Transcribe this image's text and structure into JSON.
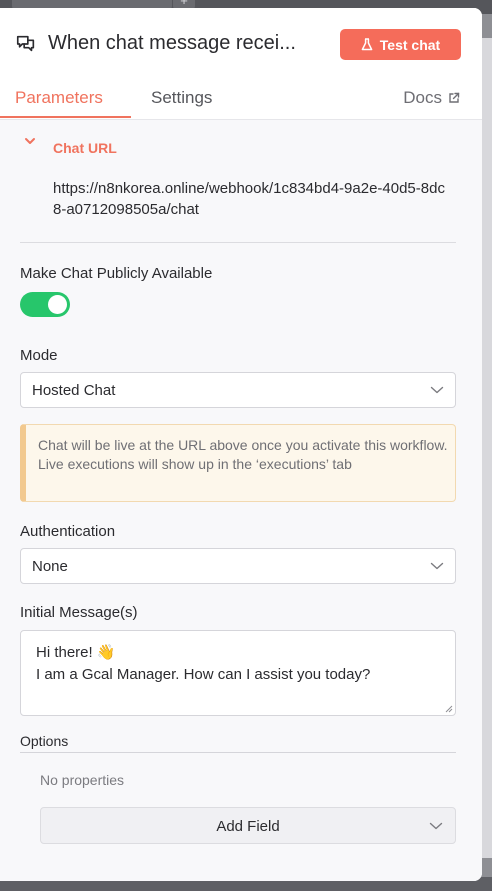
{
  "node": {
    "title": "When chat message recei...",
    "test_button": "Test chat",
    "icon": "chat-icon",
    "test_icon": "flask-icon"
  },
  "tabs": [
    {
      "label": "Parameters",
      "active": true
    },
    {
      "label": "Settings",
      "active": false
    }
  ],
  "docs": {
    "label": "Docs",
    "icon": "external-link-icon"
  },
  "chat_url": {
    "label": "Chat URL",
    "value": "https://n8nkorea.online/webhook/1c834bd4-9a2e-40d5-8dc8-a0712098505a/chat"
  },
  "public": {
    "label": "Make Chat Publicly Available",
    "enabled": true
  },
  "mode": {
    "label": "Mode",
    "value": "Hosted Chat"
  },
  "notice": "Chat will be live at the URL above once you activate this workflow. Live executions will show up in the ‘executions’ tab",
  "authentication": {
    "label": "Authentication",
    "value": "None"
  },
  "initial_messages": {
    "label": "Initial Message(s)",
    "lines": [
      "Hi there! 👋",
      "I am a Gcal Manager. How can I assist you today?"
    ]
  },
  "options": {
    "label": "Options",
    "empty_text": "No properties",
    "add_field": "Add Field"
  },
  "colors": {
    "accent": "#f0735e",
    "button": "#f56c5a",
    "toggle_on": "#27c66b"
  }
}
